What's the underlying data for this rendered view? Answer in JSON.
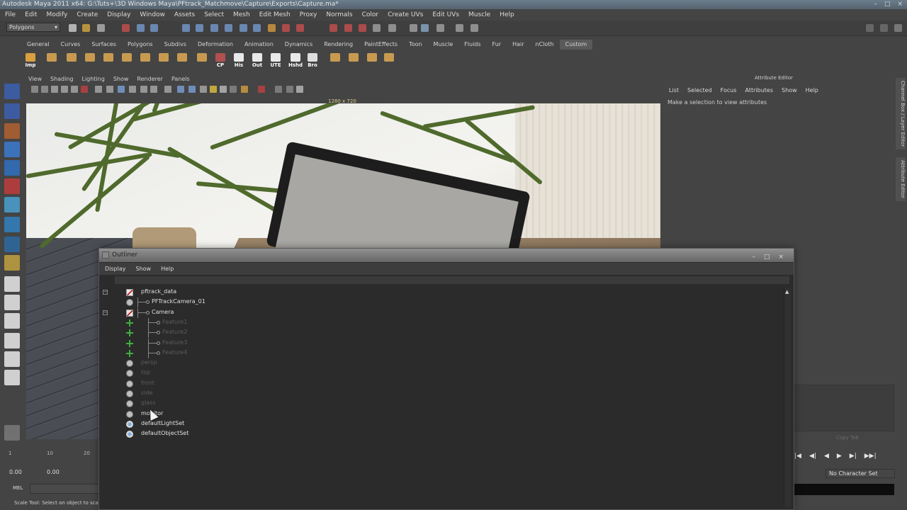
{
  "window": {
    "title": "Autodesk Maya 2011 x64: G:\\Tuts+\\3D Windows Maya\\PFtrack_Matchmove\\Capture\\Exports\\Capture.ma*",
    "controls": [
      "–",
      "□",
      "×"
    ]
  },
  "menubar": [
    "File",
    "Edit",
    "Modify",
    "Create",
    "Display",
    "Window",
    "Assets",
    "Select",
    "Mesh",
    "Edit Mesh",
    "Proxy",
    "Normals",
    "Color",
    "Create UVs",
    "Edit UVs",
    "Muscle",
    "Help"
  ],
  "status": {
    "mode": "Polygons"
  },
  "shelf": {
    "tabs": [
      "General",
      "Curves",
      "Surfaces",
      "Polygons",
      "Subdivs",
      "Deformation",
      "Animation",
      "Dynamics",
      "Rendering",
      "PaintEffects",
      "Toon",
      "Muscle",
      "Fluids",
      "Fur",
      "Hair",
      "nCloth",
      "Custom"
    ],
    "active_tab": "Custom",
    "buttons": [
      "Imp",
      "",
      "",
      "",
      "",
      "",
      "",
      "",
      "",
      "",
      "CP",
      "His",
      "Out",
      "UTE",
      "Hshd",
      "Bro",
      "",
      "",
      "",
      ""
    ]
  },
  "panel": {
    "menu": [
      "View",
      "Shading",
      "Lighting",
      "Show",
      "Renderer",
      "Panels"
    ],
    "resolution": "1280 x 720"
  },
  "attribute_editor": {
    "title": "Attribute Editor",
    "menu": [
      "List",
      "Selected",
      "Focus",
      "Attributes",
      "Show",
      "Help"
    ],
    "message": "Make a selection to view attributes",
    "side_tabs": [
      "Channel Box / Layer Editor",
      "Attribute Editor"
    ]
  },
  "outliner": {
    "title": "Outliner",
    "menu": [
      "Display",
      "Show",
      "Help"
    ],
    "rows": [
      {
        "name": "pftrack_data",
        "depth": 0,
        "icon": "transform-icon",
        "dim": false,
        "expand": "−"
      },
      {
        "name": "PFTrackCamera_01",
        "depth": 1,
        "icon": "camera-icon",
        "dim": false,
        "expand": ""
      },
      {
        "name": "Camera",
        "depth": 1,
        "icon": "transform-icon",
        "dim": false,
        "expand": "−"
      },
      {
        "name": "Feature1",
        "depth": 2,
        "icon": "locator-icon",
        "dim": true,
        "expand": ""
      },
      {
        "name": "Feature2",
        "depth": 2,
        "icon": "locator-icon",
        "dim": true,
        "expand": ""
      },
      {
        "name": "Feature3",
        "depth": 2,
        "icon": "locator-icon",
        "dim": true,
        "expand": ""
      },
      {
        "name": "Feature4",
        "depth": 2,
        "icon": "locator-icon",
        "dim": true,
        "expand": ""
      },
      {
        "name": "persp",
        "depth": 0,
        "icon": "camera-icon",
        "dim": true,
        "expand": ""
      },
      {
        "name": "top",
        "depth": 0,
        "icon": "camera-icon",
        "dim": true,
        "expand": ""
      },
      {
        "name": "front",
        "depth": 0,
        "icon": "camera-icon",
        "dim": true,
        "expand": ""
      },
      {
        "name": "side",
        "depth": 0,
        "icon": "camera-icon",
        "dim": true,
        "expand": ""
      },
      {
        "name": "glass",
        "depth": 0,
        "icon": "camera-icon",
        "dim": true,
        "expand": ""
      },
      {
        "name": "monitor",
        "depth": 0,
        "icon": "camera-icon",
        "dim": false,
        "expand": ""
      },
      {
        "name": "defaultLightSet",
        "depth": 0,
        "icon": "set-icon",
        "dim": false,
        "expand": ""
      },
      {
        "name": "defaultObjectSet",
        "depth": 0,
        "icon": "set-icon",
        "dim": false,
        "expand": ""
      }
    ]
  },
  "timeline": {
    "ticks": [
      "1",
      "10",
      "20"
    ],
    "range_start": "0.00",
    "range_end": "0.00"
  },
  "command_line": {
    "label": "MEL"
  },
  "help_line": "Scale Tool: Select an object to scale",
  "right_panel": {
    "copy_tab": "Copy Tab",
    "playback_controls": [
      "|◀",
      "◀|",
      "◀",
      "▶",
      "▶|",
      "▶▶|"
    ],
    "character_set": "No Character Set"
  }
}
